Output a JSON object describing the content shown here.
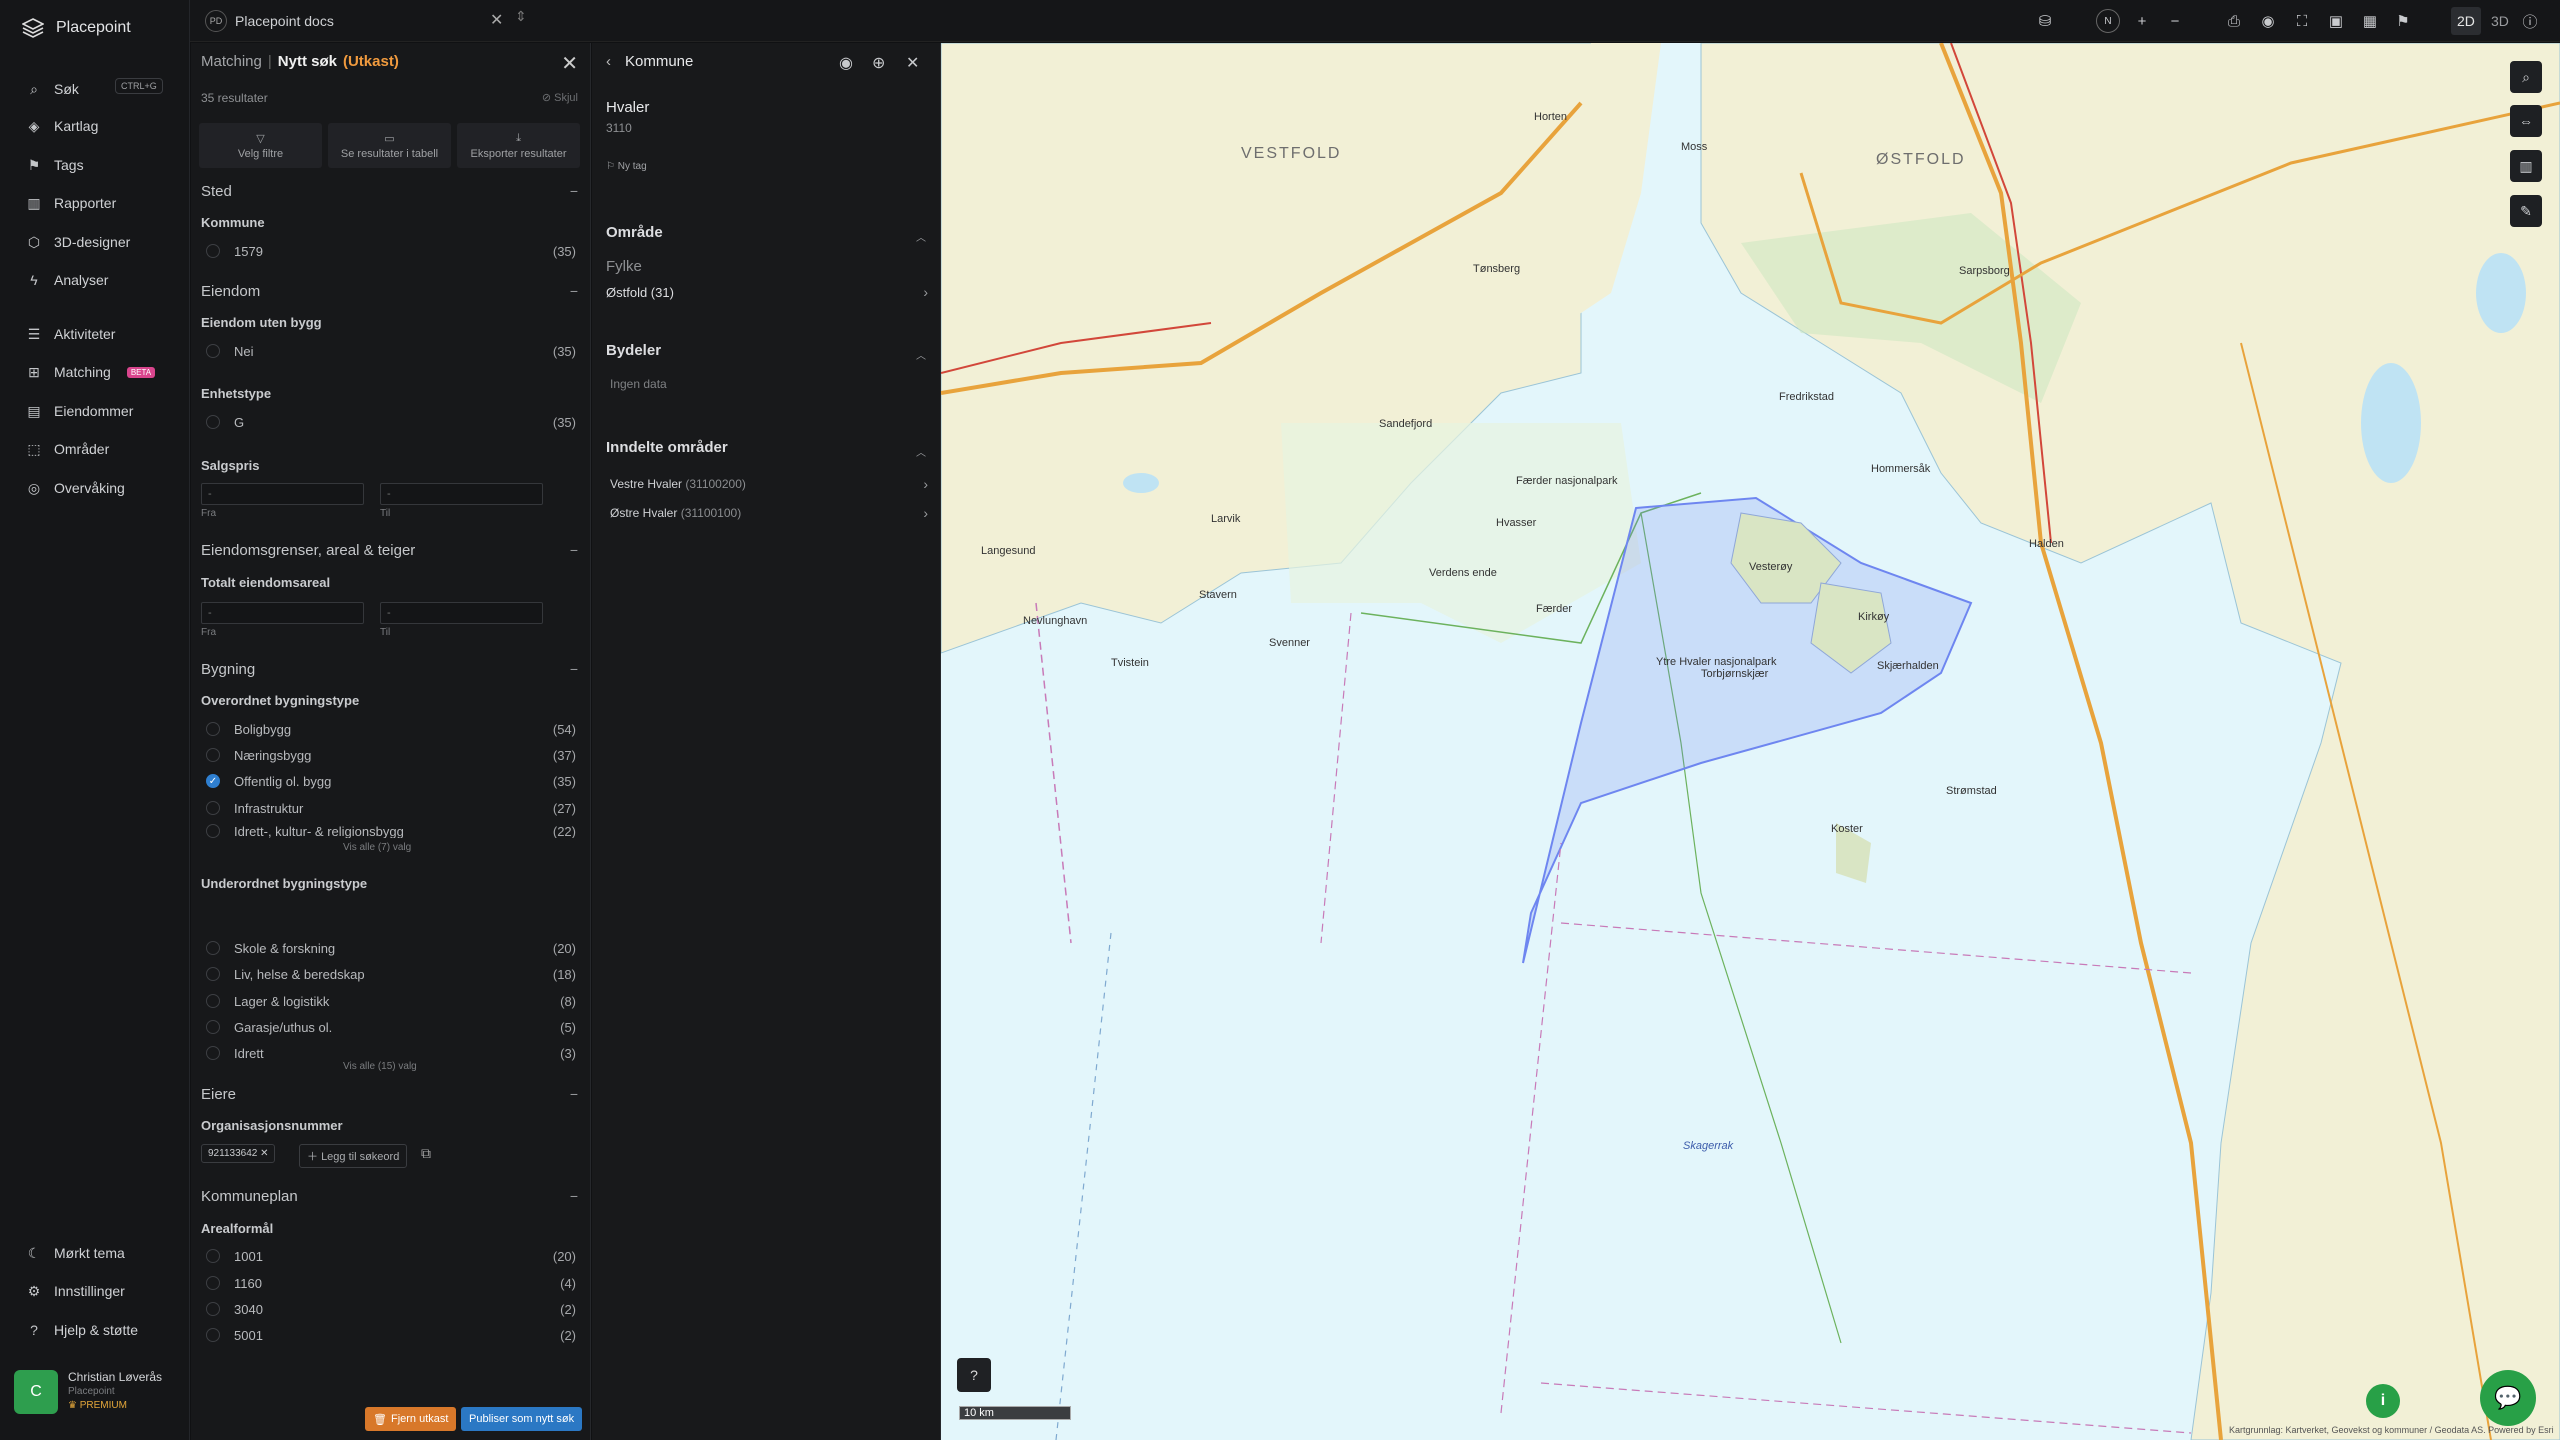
{
  "app": {
    "name": "Placepoint"
  },
  "workspace": {
    "badge": "PD",
    "name": "Placepoint docs"
  },
  "toolbar": {
    "north": "N",
    "plus": "+",
    "minus": "−",
    "mode_2d": "2D",
    "mode_3d": "3D"
  },
  "nav": {
    "search_label": "Søk",
    "search_shortcut": "CTRL+G",
    "items": [
      {
        "label": "Kartlag"
      },
      {
        "label": "Tags"
      },
      {
        "label": "Rapporter"
      },
      {
        "label": "3D-designer"
      },
      {
        "label": "Analyser"
      },
      {
        "label": "Aktiviteter"
      },
      {
        "label": "Matching",
        "badge": "BETA"
      },
      {
        "label": "Eiendommer"
      },
      {
        "label": "Områder"
      },
      {
        "label": "Overvåking"
      }
    ],
    "bottom": [
      {
        "label": "Mørkt tema"
      },
      {
        "label": "Innstillinger"
      },
      {
        "label": "Hjelp & støtte"
      }
    ],
    "user": {
      "initial": "C",
      "name": "Christian Løverås",
      "org": "Placepoint",
      "plan": "PREMIUM"
    }
  },
  "filter": {
    "breadcrumb_a": "Matching",
    "breadcrumb_sep": "|",
    "title": "Nytt søk",
    "status": "(Utkast)",
    "result_count": "35 resultater",
    "hide_label": "Skjul",
    "buttons": [
      "Velg filtre",
      "Se resultater i tabell",
      "Eksporter resultater"
    ],
    "sted": {
      "title": "Sted",
      "kommune_label": "Kommune",
      "options": [
        {
          "label": "1579",
          "count": "(35)"
        }
      ]
    },
    "eiendom": {
      "title": "Eiendom",
      "uten_bygg_label": "Eiendom uten bygg",
      "uten_bygg_options": [
        {
          "label": "Nei",
          "count": "(35)"
        }
      ],
      "enhetstype_label": "Enhetstype",
      "enhetstype_options": [
        {
          "label": "G",
          "count": "(35)"
        }
      ],
      "salgspris_label": "Salgspris",
      "from_placeholder": "-",
      "to_placeholder": "-",
      "from_label": "Fra",
      "to_label": "Til"
    },
    "grenser": {
      "title": "Eiendomsgrenser, areal & teiger",
      "areal_label": "Totalt eiendomsareal",
      "from_placeholder": "-",
      "to_placeholder": "-",
      "from_label": "Fra",
      "to_label": "Til"
    },
    "bygning": {
      "title": "Bygning",
      "overordnet_label": "Overordnet bygningstype",
      "overordnet_options": [
        {
          "label": "Boligbygg",
          "count": "(54)",
          "checked": false
        },
        {
          "label": "Næringsbygg",
          "count": "(37)",
          "checked": false
        },
        {
          "label": "Offentlig ol. bygg",
          "count": "(35)",
          "checked": true
        },
        {
          "label": "Infrastruktur",
          "count": "(27)",
          "checked": false
        },
        {
          "label": "Idrett-, kultur- & religionsbygg",
          "count": "(22)",
          "checked": false
        }
      ],
      "overordnet_more": "Vis alle (7) valg",
      "underordnet_label": "Underordnet bygningstype",
      "underordnet_options": [
        {
          "label": "Skole & forskning",
          "count": "(20)"
        },
        {
          "label": "Liv, helse & beredskap",
          "count": "(18)"
        },
        {
          "label": "Lager & logistikk",
          "count": "(8)"
        },
        {
          "label": "Garasje/uthus ol.",
          "count": "(5)"
        },
        {
          "label": "Idrett",
          "count": "(3)"
        }
      ],
      "underordnet_more": "Vis alle (15) valg"
    },
    "eiere": {
      "title": "Eiere",
      "org_label": "Organisasjonsnummer",
      "chip": "921133642",
      "add_label": "Legg til søkeord"
    },
    "kommuneplan": {
      "title": "Kommuneplan",
      "areal_label": "Arealformål",
      "options": [
        {
          "label": "1001",
          "count": "(20)"
        },
        {
          "label": "1160",
          "count": "(4)"
        },
        {
          "label": "3040",
          "count": "(2)"
        },
        {
          "label": "5001",
          "count": "(2)"
        }
      ]
    },
    "remove_draft": "Fjern utkast",
    "publish": "Publiser som nytt søk"
  },
  "kommune": {
    "title": "Kommune",
    "name": "Hvaler",
    "code": "3110",
    "new_tag": "Ny tag",
    "omrade_title": "Område",
    "fylke_label": "Fylke",
    "fylke_value": "Østfold (31)",
    "bydeler_title": "Bydeler",
    "bydeler_empty": "Ingen data",
    "inndelte_title": "Inndelte områder",
    "inndelte": [
      {
        "name": "Vestre Hvaler",
        "code": "(31100200)"
      },
      {
        "name": "Østre Hvaler",
        "code": "(31100100)"
      }
    ]
  },
  "map": {
    "regions": [
      "VESTFOLD",
      "ØSTFOLD"
    ],
    "places": [
      "Horten",
      "Tønsberg",
      "Sandefjord",
      "Larvik",
      "Stavern",
      "Svenner",
      "Tvistein",
      "Færder",
      "Verdens ende",
      "Hvasser",
      "Fredrikstad",
      "Sarpsborg",
      "Halden",
      "Moss",
      "Kirkøy",
      "Vesterøy",
      "Skjærhalden",
      "Færder nasjonalpark",
      "Ytre Hvaler nasjonalpark",
      "Torbjørnskjær",
      "Strømstad",
      "Skagerrak",
      "Nevlunghavn",
      "Langesund",
      "Hommersåk",
      "Koster"
    ],
    "scale": "10 km",
    "attribution": "Kartgrunnlag: Kartverket, Geovekst og kommuner / Geodata AS. Powered by Esri",
    "colors": {
      "sea": "#e3f6fb",
      "land": "#f2f0d6",
      "park": "#cfe7c2",
      "selection": "#6e86f0"
    }
  }
}
